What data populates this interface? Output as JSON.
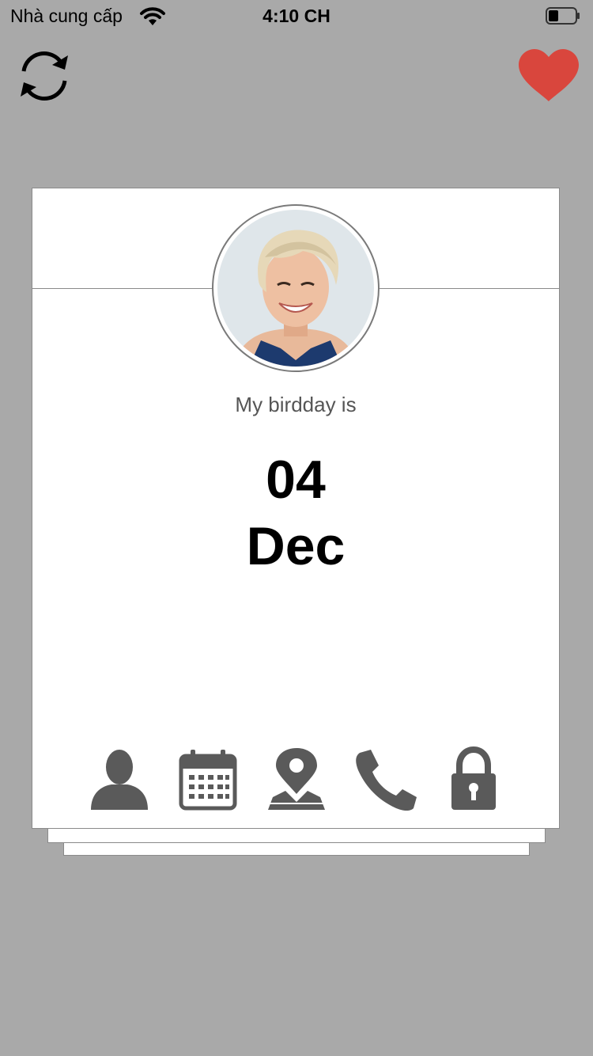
{
  "status_bar": {
    "carrier": "Nhà cung cấp",
    "time": "4:10 CH"
  },
  "colors": {
    "background": "#a9a9a9",
    "heart": "#d9463d",
    "icon": "#5a5a5a"
  },
  "card": {
    "label": "My birdday is",
    "value_line1": "04",
    "value_line2": "Dec"
  },
  "tabs": [
    {
      "name": "user-icon"
    },
    {
      "name": "calendar-icon"
    },
    {
      "name": "map-pin-icon"
    },
    {
      "name": "phone-icon"
    },
    {
      "name": "lock-icon"
    }
  ]
}
